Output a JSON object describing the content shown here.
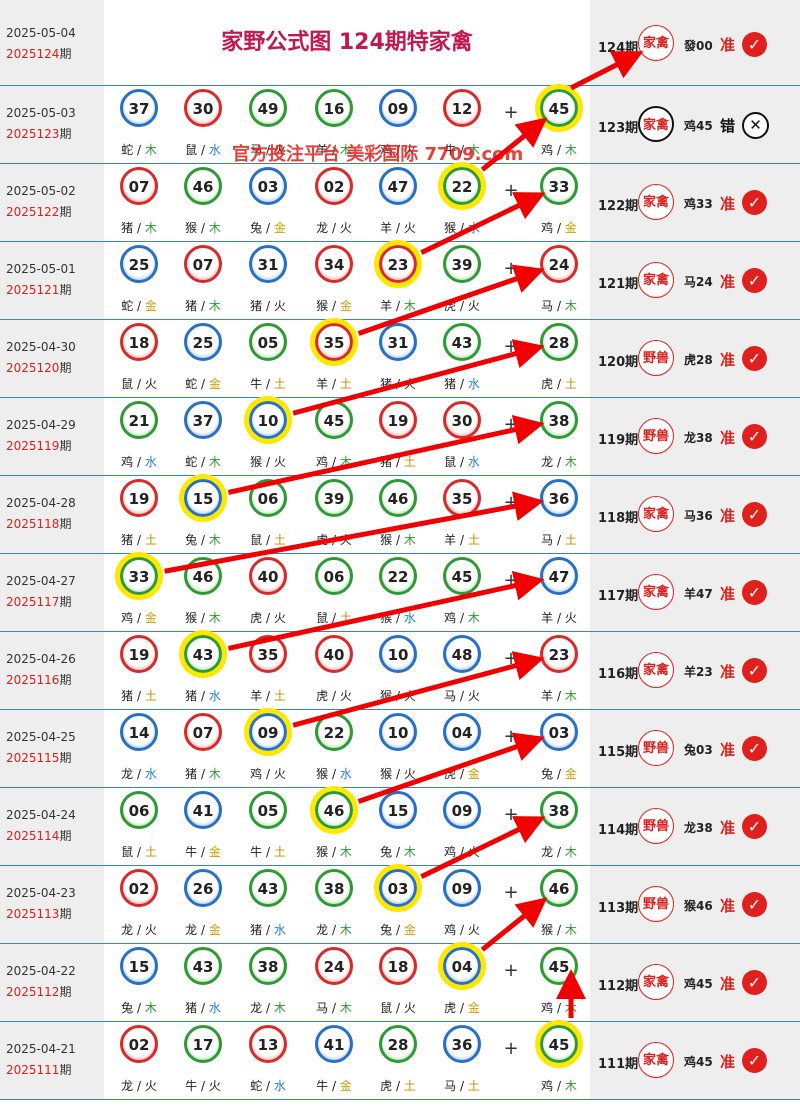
{
  "header": {
    "date": "2025-05-04",
    "period": "2025124",
    "period_suffix": "期",
    "title": "家野公式图 124期特家禽",
    "right": {
      "label": "124期",
      "stamp": "家禽",
      "animal": "發00",
      "verdict": "准",
      "result": "correct"
    }
  },
  "watermark": "官方投注平台 美彩国际 7709.com",
  "colors": {
    "red_ball": "#d92a2a",
    "blue_ball": "#2770c5",
    "green_ball": "#2f9a35",
    "highlight": "#ffe800",
    "arrow": "#f00000",
    "accent": "#e0201c"
  },
  "rows": [
    {
      "date": "2025-05-03",
      "period": "2025123",
      "suffix": "期",
      "plus": "+",
      "balls": [
        {
          "num": "37",
          "color": "blue",
          "zodiac": "蛇",
          "element": "木"
        },
        {
          "num": "30",
          "color": "red",
          "zodiac": "鼠",
          "element": "水"
        },
        {
          "num": "49",
          "color": "green",
          "zodiac": "马",
          "element": "火"
        },
        {
          "num": "16",
          "color": "green",
          "zodiac": "羊",
          "element": "木"
        },
        {
          "num": "09",
          "color": "blue",
          "zodiac": "鸡",
          "element": "火"
        },
        {
          "num": "12",
          "color": "red",
          "zodiac": "牛",
          "element": "木"
        },
        {
          "num": "45",
          "color": "green",
          "zodiac": "鸡",
          "element": "木"
        }
      ],
      "right": {
        "label": "123期",
        "stamp": "家禽",
        "animal": "鸡45",
        "verdict": "错",
        "result": "wrong"
      }
    },
    {
      "date": "2025-05-02",
      "period": "2025122",
      "suffix": "期",
      "plus": "+",
      "balls": [
        {
          "num": "07",
          "color": "red",
          "zodiac": "猪",
          "element": "木"
        },
        {
          "num": "46",
          "color": "green",
          "zodiac": "猴",
          "element": "木"
        },
        {
          "num": "03",
          "color": "blue",
          "zodiac": "兔",
          "element": "金"
        },
        {
          "num": "02",
          "color": "red",
          "zodiac": "龙",
          "element": "火"
        },
        {
          "num": "47",
          "color": "blue",
          "zodiac": "羊",
          "element": "火"
        },
        {
          "num": "22",
          "color": "green",
          "zodiac": "猴",
          "element": "水"
        },
        {
          "num": "33",
          "color": "green",
          "zodiac": "鸡",
          "element": "金"
        }
      ],
      "right": {
        "label": "122期",
        "stamp": "家禽",
        "animal": "鸡33",
        "verdict": "准",
        "result": "correct"
      }
    },
    {
      "date": "2025-05-01",
      "period": "2025121",
      "suffix": "期",
      "plus": "+",
      "balls": [
        {
          "num": "25",
          "color": "blue",
          "zodiac": "蛇",
          "element": "金"
        },
        {
          "num": "07",
          "color": "red",
          "zodiac": "猪",
          "element": "木"
        },
        {
          "num": "31",
          "color": "blue",
          "zodiac": "猪",
          "element": "火"
        },
        {
          "num": "34",
          "color": "red",
          "zodiac": "猴",
          "element": "金"
        },
        {
          "num": "23",
          "color": "red",
          "zodiac": "羊",
          "element": "木"
        },
        {
          "num": "39",
          "color": "green",
          "zodiac": "虎",
          "element": "火"
        },
        {
          "num": "24",
          "color": "red",
          "zodiac": "马",
          "element": "木"
        }
      ],
      "right": {
        "label": "121期",
        "stamp": "家禽",
        "animal": "马24",
        "verdict": "准",
        "result": "correct"
      }
    },
    {
      "date": "2025-04-30",
      "period": "2025120",
      "suffix": "期",
      "plus": "+",
      "balls": [
        {
          "num": "18",
          "color": "red",
          "zodiac": "鼠",
          "element": "火"
        },
        {
          "num": "25",
          "color": "blue",
          "zodiac": "蛇",
          "element": "金"
        },
        {
          "num": "05",
          "color": "green",
          "zodiac": "牛",
          "element": "土"
        },
        {
          "num": "35",
          "color": "red",
          "zodiac": "羊",
          "element": "土"
        },
        {
          "num": "31",
          "color": "blue",
          "zodiac": "猪",
          "element": "火"
        },
        {
          "num": "43",
          "color": "green",
          "zodiac": "猪",
          "element": "水"
        },
        {
          "num": "28",
          "color": "green",
          "zodiac": "虎",
          "element": "土"
        }
      ],
      "right": {
        "label": "120期",
        "stamp": "野兽",
        "animal": "虎28",
        "verdict": "准",
        "result": "correct"
      }
    },
    {
      "date": "2025-04-29",
      "period": "2025119",
      "suffix": "期",
      "plus": "+",
      "balls": [
        {
          "num": "21",
          "color": "green",
          "zodiac": "鸡",
          "element": "水"
        },
        {
          "num": "37",
          "color": "blue",
          "zodiac": "蛇",
          "element": "木"
        },
        {
          "num": "10",
          "color": "blue",
          "zodiac": "猴",
          "element": "火"
        },
        {
          "num": "45",
          "color": "green",
          "zodiac": "鸡",
          "element": "木"
        },
        {
          "num": "19",
          "color": "red",
          "zodiac": "猪",
          "element": "土"
        },
        {
          "num": "30",
          "color": "red",
          "zodiac": "鼠",
          "element": "水"
        },
        {
          "num": "38",
          "color": "green",
          "zodiac": "龙",
          "element": "木"
        }
      ],
      "right": {
        "label": "119期",
        "stamp": "野兽",
        "animal": "龙38",
        "verdict": "准",
        "result": "correct"
      }
    },
    {
      "date": "2025-04-28",
      "period": "2025118",
      "suffix": "期",
      "plus": "+",
      "balls": [
        {
          "num": "19",
          "color": "red",
          "zodiac": "猪",
          "element": "土"
        },
        {
          "num": "15",
          "color": "blue",
          "zodiac": "兔",
          "element": "木"
        },
        {
          "num": "06",
          "color": "green",
          "zodiac": "鼠",
          "element": "土"
        },
        {
          "num": "39",
          "color": "green",
          "zodiac": "虎",
          "element": "火"
        },
        {
          "num": "46",
          "color": "green",
          "zodiac": "猴",
          "element": "木"
        },
        {
          "num": "35",
          "color": "red",
          "zodiac": "羊",
          "element": "土"
        },
        {
          "num": "36",
          "color": "blue",
          "zodiac": "马",
          "element": "土"
        }
      ],
      "right": {
        "label": "118期",
        "stamp": "家禽",
        "animal": "马36",
        "verdict": "准",
        "result": "correct"
      }
    },
    {
      "date": "2025-04-27",
      "period": "2025117",
      "suffix": "期",
      "plus": "+",
      "balls": [
        {
          "num": "33",
          "color": "green",
          "zodiac": "鸡",
          "element": "金"
        },
        {
          "num": "46",
          "color": "green",
          "zodiac": "猴",
          "element": "木"
        },
        {
          "num": "40",
          "color": "red",
          "zodiac": "虎",
          "element": "火"
        },
        {
          "num": "06",
          "color": "green",
          "zodiac": "鼠",
          "element": "土"
        },
        {
          "num": "22",
          "color": "green",
          "zodiac": "猴",
          "element": "水"
        },
        {
          "num": "45",
          "color": "green",
          "zodiac": "鸡",
          "element": "木"
        },
        {
          "num": "47",
          "color": "blue",
          "zodiac": "羊",
          "element": "火"
        }
      ],
      "right": {
        "label": "117期",
        "stamp": "家禽",
        "animal": "羊47",
        "verdict": "准",
        "result": "correct"
      }
    },
    {
      "date": "2025-04-26",
      "period": "2025116",
      "suffix": "期",
      "plus": "+",
      "balls": [
        {
          "num": "19",
          "color": "red",
          "zodiac": "猪",
          "element": "土"
        },
        {
          "num": "43",
          "color": "green",
          "zodiac": "猪",
          "element": "水"
        },
        {
          "num": "35",
          "color": "red",
          "zodiac": "羊",
          "element": "土"
        },
        {
          "num": "40",
          "color": "red",
          "zodiac": "虎",
          "element": "火"
        },
        {
          "num": "10",
          "color": "blue",
          "zodiac": "猴",
          "element": "火"
        },
        {
          "num": "48",
          "color": "blue",
          "zodiac": "马",
          "element": "火"
        },
        {
          "num": "23",
          "color": "red",
          "zodiac": "羊",
          "element": "木"
        }
      ],
      "right": {
        "label": "116期",
        "stamp": "家禽",
        "animal": "羊23",
        "verdict": "准",
        "result": "correct"
      }
    },
    {
      "date": "2025-04-25",
      "period": "2025115",
      "suffix": "期",
      "plus": "+",
      "balls": [
        {
          "num": "14",
          "color": "blue",
          "zodiac": "龙",
          "element": "水"
        },
        {
          "num": "07",
          "color": "red",
          "zodiac": "猪",
          "element": "木"
        },
        {
          "num": "09",
          "color": "blue",
          "zodiac": "鸡",
          "element": "火"
        },
        {
          "num": "22",
          "color": "green",
          "zodiac": "猴",
          "element": "水"
        },
        {
          "num": "10",
          "color": "blue",
          "zodiac": "猴",
          "element": "火"
        },
        {
          "num": "04",
          "color": "blue",
          "zodiac": "虎",
          "element": "金"
        },
        {
          "num": "03",
          "color": "blue",
          "zodiac": "兔",
          "element": "金"
        }
      ],
      "right": {
        "label": "115期",
        "stamp": "野兽",
        "animal": "兔03",
        "verdict": "准",
        "result": "correct"
      }
    },
    {
      "date": "2025-04-24",
      "period": "2025114",
      "suffix": "期",
      "plus": "+",
      "balls": [
        {
          "num": "06",
          "color": "green",
          "zodiac": "鼠",
          "element": "土"
        },
        {
          "num": "41",
          "color": "blue",
          "zodiac": "牛",
          "element": "金"
        },
        {
          "num": "05",
          "color": "green",
          "zodiac": "牛",
          "element": "土"
        },
        {
          "num": "46",
          "color": "green",
          "zodiac": "猴",
          "element": "木"
        },
        {
          "num": "15",
          "color": "blue",
          "zodiac": "兔",
          "element": "木"
        },
        {
          "num": "09",
          "color": "blue",
          "zodiac": "鸡",
          "element": "火"
        },
        {
          "num": "38",
          "color": "green",
          "zodiac": "龙",
          "element": "木"
        }
      ],
      "right": {
        "label": "114期",
        "stamp": "野兽",
        "animal": "龙38",
        "verdict": "准",
        "result": "correct"
      }
    },
    {
      "date": "2025-04-23",
      "period": "2025113",
      "suffix": "期",
      "plus": "+",
      "balls": [
        {
          "num": "02",
          "color": "red",
          "zodiac": "龙",
          "element": "火"
        },
        {
          "num": "26",
          "color": "blue",
          "zodiac": "龙",
          "element": "金"
        },
        {
          "num": "43",
          "color": "green",
          "zodiac": "猪",
          "element": "水"
        },
        {
          "num": "38",
          "color": "green",
          "zodiac": "龙",
          "element": "木"
        },
        {
          "num": "03",
          "color": "blue",
          "zodiac": "兔",
          "element": "金"
        },
        {
          "num": "09",
          "color": "blue",
          "zodiac": "鸡",
          "element": "火"
        },
        {
          "num": "46",
          "color": "green",
          "zodiac": "猴",
          "element": "木"
        }
      ],
      "right": {
        "label": "113期",
        "stamp": "野兽",
        "animal": "猴46",
        "verdict": "准",
        "result": "correct"
      }
    },
    {
      "date": "2025-04-22",
      "period": "2025112",
      "suffix": "期",
      "plus": "+",
      "balls": [
        {
          "num": "15",
          "color": "blue",
          "zodiac": "兔",
          "element": "木"
        },
        {
          "num": "43",
          "color": "green",
          "zodiac": "猪",
          "element": "水"
        },
        {
          "num": "38",
          "color": "green",
          "zodiac": "龙",
          "element": "木"
        },
        {
          "num": "24",
          "color": "red",
          "zodiac": "马",
          "element": "木"
        },
        {
          "num": "18",
          "color": "red",
          "zodiac": "鼠",
          "element": "火"
        },
        {
          "num": "04",
          "color": "blue",
          "zodiac": "虎",
          "element": "金"
        },
        {
          "num": "45",
          "color": "green",
          "zodiac": "鸡",
          "element": "木"
        }
      ],
      "right": {
        "label": "112期",
        "stamp": "家禽",
        "animal": "鸡45",
        "verdict": "准",
        "result": "correct"
      }
    },
    {
      "date": "2025-04-21",
      "period": "2025111",
      "suffix": "期",
      "plus": "+",
      "balls": [
        {
          "num": "02",
          "color": "red",
          "zodiac": "龙",
          "element": "火"
        },
        {
          "num": "17",
          "color": "green",
          "zodiac": "牛",
          "element": "火"
        },
        {
          "num": "13",
          "color": "red",
          "zodiac": "蛇",
          "element": "水"
        },
        {
          "num": "41",
          "color": "blue",
          "zodiac": "牛",
          "element": "金"
        },
        {
          "num": "28",
          "color": "green",
          "zodiac": "虎",
          "element": "土"
        },
        {
          "num": "36",
          "color": "blue",
          "zodiac": "马",
          "element": "土"
        },
        {
          "num": "45",
          "color": "green",
          "zodiac": "鸡",
          "element": "木"
        }
      ],
      "right": {
        "label": "111期",
        "stamp": "家禽",
        "animal": "鸡45",
        "verdict": "准",
        "result": "correct"
      }
    }
  ],
  "highlights": [
    {
      "row": 0,
      "ball": 6
    },
    {
      "row": 1,
      "ball": 5
    },
    {
      "row": 2,
      "ball": 4
    },
    {
      "row": 3,
      "ball": 3
    },
    {
      "row": 4,
      "ball": 2
    },
    {
      "row": 5,
      "ball": 1
    },
    {
      "row": 6,
      "ball": 0
    },
    {
      "row": 7,
      "ball": 1
    },
    {
      "row": 8,
      "ball": 2
    },
    {
      "row": 9,
      "ball": 3
    },
    {
      "row": 10,
      "ball": 4
    },
    {
      "row": 11,
      "ball": 5
    },
    {
      "row": 12,
      "ball": 6
    }
  ]
}
